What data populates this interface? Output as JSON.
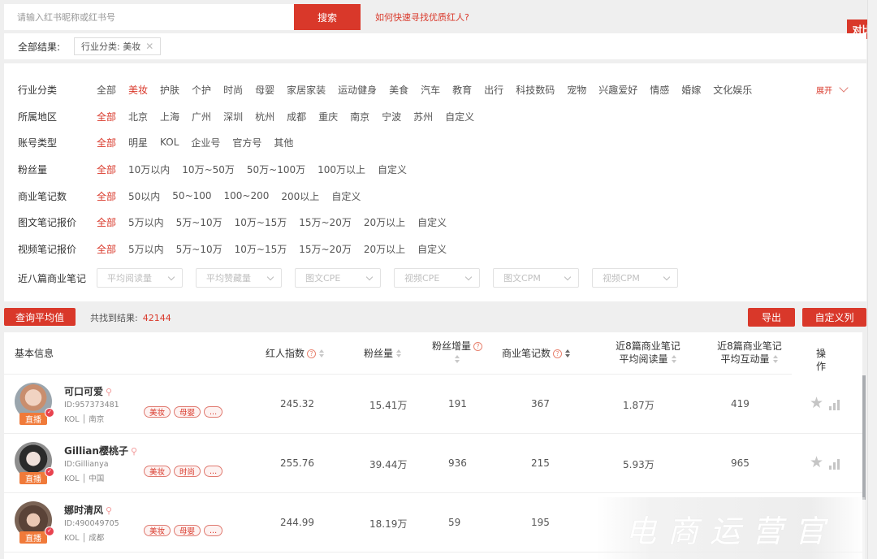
{
  "search": {
    "placeholder": "请输入红书昵称或红书号",
    "button": "搜索",
    "help_link": "如何快速寻找优质红人?"
  },
  "compare_button": "对比",
  "results": {
    "label": "全部结果:",
    "chips": [
      {
        "label": "行业分类: 美妆"
      }
    ]
  },
  "filters": [
    {
      "label": "行业分类",
      "options": [
        "全部",
        "美妆",
        "护肤",
        "个护",
        "时尚",
        "母婴",
        "家居家装",
        "运动健身",
        "美食",
        "汽车",
        "教育",
        "出行",
        "科技数码",
        "宠物",
        "兴趣爱好",
        "情感",
        "婚嫁",
        "文化娱乐"
      ],
      "active": "美妆"
    },
    {
      "label": "所属地区",
      "options": [
        "全部",
        "北京",
        "上海",
        "广州",
        "深圳",
        "杭州",
        "成都",
        "重庆",
        "南京",
        "宁波",
        "苏州",
        "自定义"
      ],
      "active": "全部"
    },
    {
      "label": "账号类型",
      "options": [
        "全部",
        "明星",
        "KOL",
        "企业号",
        "官方号",
        "其他"
      ],
      "active": "全部"
    },
    {
      "label": "粉丝量",
      "options": [
        "全部",
        "10万以内",
        "10万~50万",
        "50万~100万",
        "100万以上",
        "自定义"
      ],
      "active": "全部"
    },
    {
      "label": "商业笔记数",
      "options": [
        "全部",
        "50以内",
        "50~100",
        "100~200",
        "200以上",
        "自定义"
      ],
      "active": "全部"
    },
    {
      "label": "图文笔记报价",
      "options": [
        "全部",
        "5万以内",
        "5万~10万",
        "10万~15万",
        "15万~20万",
        "20万以上",
        "自定义"
      ],
      "active": "全部"
    },
    {
      "label": "视频笔记报价",
      "options": [
        "全部",
        "5万以内",
        "5万~10万",
        "10万~15万",
        "15万~20万",
        "20万以上",
        "自定义"
      ],
      "active": "全部"
    }
  ],
  "expand_label": "展开",
  "recent_notes": {
    "label": "近八篇商业笔记",
    "selects": [
      "平均阅读量",
      "平均赞藏量",
      "图文CPE",
      "视频CPE",
      "图文CPM",
      "视频CPM"
    ]
  },
  "actions": {
    "avg_button": "查询平均值",
    "found_label": "共找到结果:",
    "found_count": "42144",
    "export_button": "导出",
    "custom_columns_button": "自定义列"
  },
  "table": {
    "headers": {
      "basic": "基本信息",
      "index": "红人指数",
      "fans": "粉丝量",
      "fans_growth": "粉丝增量",
      "notes": "商业笔记数",
      "avg_read_1": "近8篇商业笔记",
      "avg_read_2": "平均阅读量",
      "avg_inter_1": "近8篇商业笔记",
      "avg_inter_2": "平均互动量",
      "ops": "操作"
    },
    "rows": [
      {
        "name": "可口可爱",
        "id": "ID:957373481",
        "meta": "KOL │ 南京",
        "live": "直播",
        "tags": [
          "美妆",
          "母婴",
          "..."
        ],
        "index": "245.32",
        "fans": "15.41万",
        "growth": "191",
        "notes": "367",
        "avg_read": "1.87万",
        "avg_inter": "419"
      },
      {
        "name": "Gillian樱桃子",
        "id": "ID:Gillianya",
        "meta": "KOL │ 中国",
        "live": "直播",
        "tags": [
          "美妆",
          "时尚",
          "..."
        ],
        "index": "255.76",
        "fans": "39.44万",
        "growth": "936",
        "notes": "215",
        "avg_read": "5.93万",
        "avg_inter": "965"
      },
      {
        "name": "娜时清风",
        "id": "ID:490049705",
        "meta": "KOL │ 成都",
        "live": "直播",
        "tags": [
          "美妆",
          "母婴",
          "..."
        ],
        "index": "244.99",
        "fans": "18.19万",
        "growth": "59",
        "notes": "195",
        "avg_read": null,
        "avg_inter": null
      }
    ]
  },
  "watermark": "电商运营官",
  "colors": {
    "accent": "#d9382a",
    "live_badge": "#f07a3a",
    "background": "#efefef"
  }
}
